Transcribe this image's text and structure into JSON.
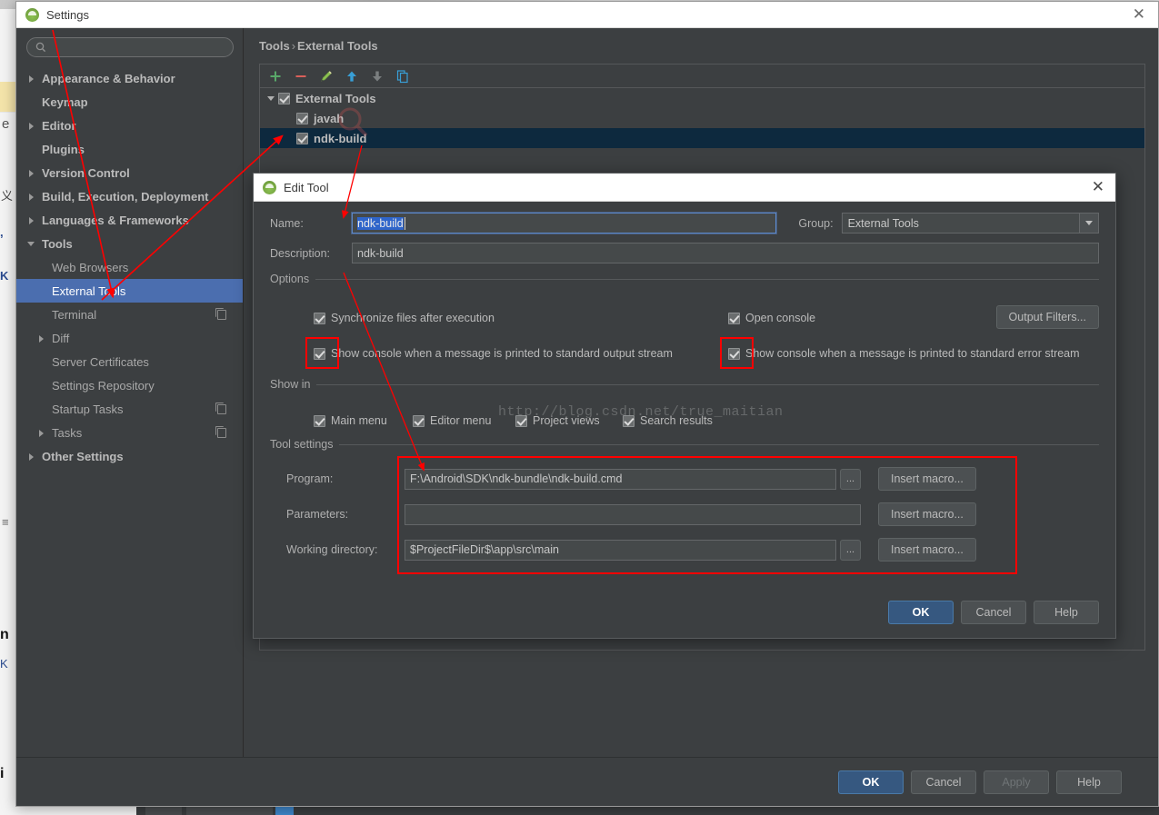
{
  "window": {
    "title": "Settings",
    "close_label": "✕",
    "icon": "android-droid-icon"
  },
  "search": {
    "placeholder": "",
    "value": "",
    "icon": "search-icon"
  },
  "sidebar": {
    "items": [
      {
        "label": "Appearance & Behavior",
        "level": 0,
        "arrow": "right",
        "badge": false
      },
      {
        "label": "Keymap",
        "level": 0,
        "arrow": "none",
        "badge": false
      },
      {
        "label": "Editor",
        "level": 0,
        "arrow": "right",
        "badge": false
      },
      {
        "label": "Plugins",
        "level": 0,
        "arrow": "none",
        "badge": false
      },
      {
        "label": "Version Control",
        "level": 0,
        "arrow": "right",
        "badge": false
      },
      {
        "label": "Build, Execution, Deployment",
        "level": 0,
        "arrow": "right",
        "badge": false
      },
      {
        "label": "Languages & Frameworks",
        "level": 0,
        "arrow": "right",
        "badge": false
      },
      {
        "label": "Tools",
        "level": 0,
        "arrow": "down",
        "badge": false
      },
      {
        "label": "Web Browsers",
        "level": 1,
        "arrow": "none",
        "badge": false
      },
      {
        "label": "External Tools",
        "level": 1,
        "arrow": "none",
        "badge": false,
        "selected": true
      },
      {
        "label": "Terminal",
        "level": 1,
        "arrow": "none",
        "badge": true
      },
      {
        "label": "Diff",
        "level": 1,
        "arrow": "right",
        "badge": false
      },
      {
        "label": "Server Certificates",
        "level": 1,
        "arrow": "none",
        "badge": false
      },
      {
        "label": "Settings Repository",
        "level": 1,
        "arrow": "none",
        "badge": false
      },
      {
        "label": "Startup Tasks",
        "level": 1,
        "arrow": "none",
        "badge": true
      },
      {
        "label": "Tasks",
        "level": 1,
        "arrow": "right",
        "badge": true
      },
      {
        "label": "Other Settings",
        "level": 0,
        "arrow": "right",
        "badge": false
      }
    ]
  },
  "content": {
    "breadcrumb": {
      "parent": "Tools",
      "separator": "›",
      "current": "External Tools"
    },
    "toolbar": [
      {
        "name": "add-icon",
        "label": "+"
      },
      {
        "name": "remove-icon",
        "label": "−"
      },
      {
        "name": "edit-pencil-icon",
        "label": "edit"
      },
      {
        "name": "move-up-icon",
        "label": "up"
      },
      {
        "name": "move-down-icon",
        "label": "down"
      },
      {
        "name": "copy-icon",
        "label": "copy"
      }
    ],
    "tree": [
      {
        "label": "External Tools",
        "checked": true,
        "expanded": true,
        "child": false,
        "selected": false
      },
      {
        "label": "javah",
        "checked": true,
        "expanded": false,
        "child": true,
        "selected": false
      },
      {
        "label": "ndk-build",
        "checked": true,
        "expanded": false,
        "child": true,
        "selected": true
      }
    ]
  },
  "footer": {
    "ok": "OK",
    "cancel": "Cancel",
    "apply": "Apply",
    "help": "Help"
  },
  "dialog": {
    "title": "Edit Tool",
    "close_label": "✕",
    "name_label": "Name:",
    "name_value": "ndk-build",
    "group_label": "Group:",
    "group_value": "External Tools",
    "description_label": "Description:",
    "description_value": "ndk-build",
    "options_group": "Options",
    "options": [
      {
        "label": "Synchronize files after execution",
        "checked": true,
        "highlighted": false
      },
      {
        "label": "Open console",
        "checked": true,
        "highlighted": false
      },
      {
        "label": "Show console when a message is printed to standard output stream",
        "checked": true,
        "highlighted": true
      },
      {
        "label": "Show console when a message is printed to standard error stream",
        "checked": true,
        "highlighted": true
      }
    ],
    "output_filters_label": "Output Filters...",
    "show_in_group": "Show in",
    "show_in": [
      {
        "label": "Main menu",
        "checked": true
      },
      {
        "label": "Editor menu",
        "checked": true
      },
      {
        "label": "Project views",
        "checked": true
      },
      {
        "label": "Search results",
        "checked": true
      }
    ],
    "tool_settings_group": "Tool settings",
    "tool_settings": [
      {
        "label": "Program:",
        "value": "F:\\Android\\SDK\\ndk-bundle\\ndk-build.cmd",
        "has_browse": true,
        "macro_label": "Insert macro..."
      },
      {
        "label": "Parameters:",
        "value": "",
        "has_browse": false,
        "macro_label": "Insert macro..."
      },
      {
        "label": "Working directory:",
        "value": "$ProjectFileDir$\\app\\src\\main",
        "has_browse": true,
        "macro_label": "Insert macro..."
      }
    ],
    "browse_label": "...",
    "buttons": {
      "ok": "OK",
      "cancel": "Cancel",
      "help": "Help"
    }
  },
  "watermark": {
    "url": "http://blog.csdn.net/true_maitian"
  },
  "colors": {
    "accent_blue": "#4b6eaf",
    "primary_button": "#365880",
    "panel_bg": "#3c3f41",
    "field_bg": "#45494a",
    "text": "#bbbbbb",
    "annotation_red": "#ff0000",
    "tree_selected": "#0d293e",
    "selection_blue": "#2f65ca"
  }
}
